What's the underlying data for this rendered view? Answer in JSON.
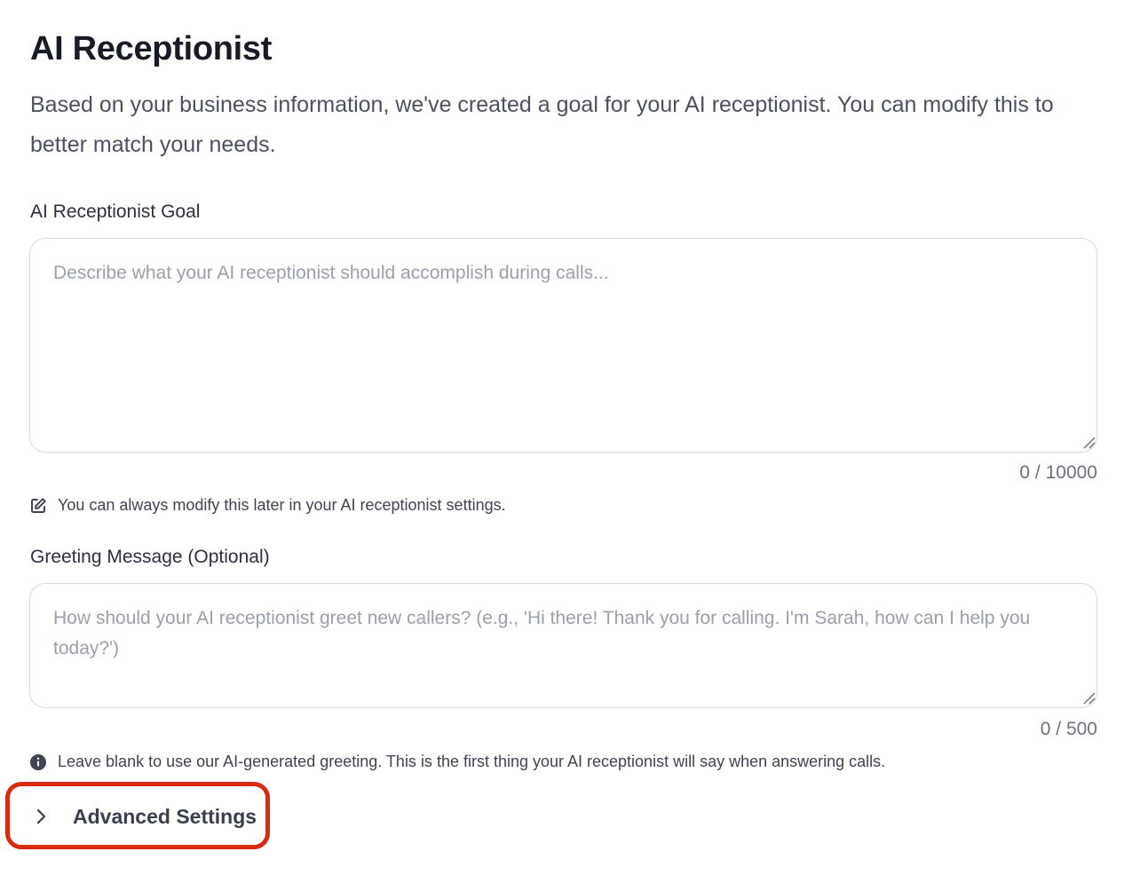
{
  "header": {
    "title": "AI Receptionist",
    "description": "Based on your business information, we've created a goal for your AI receptionist. You can modify this to better match your needs."
  },
  "goal": {
    "label": "AI Receptionist Goal",
    "value": "",
    "placeholder": "Describe what your AI receptionist should accomplish during calls...",
    "count": "0 / 10000",
    "helper": "You can always modify this later in your AI receptionist settings.",
    "helper_icon": "edit-icon"
  },
  "greeting": {
    "label": "Greeting Message (Optional)",
    "value": "",
    "placeholder": "How should your AI receptionist greet new callers? (e.g., 'Hi there! Thank you for calling. I'm Sarah, how can I help you today?')",
    "count": "0 / 500",
    "helper": "Leave blank to use our AI-generated greeting. This is the first thing your AI receptionist will say when answering calls.",
    "helper_icon": "info-icon"
  },
  "advanced": {
    "label": "Advanced Settings",
    "icon": "chevron-right-icon",
    "expanded": false,
    "highlight_color": "#d92b12"
  }
}
